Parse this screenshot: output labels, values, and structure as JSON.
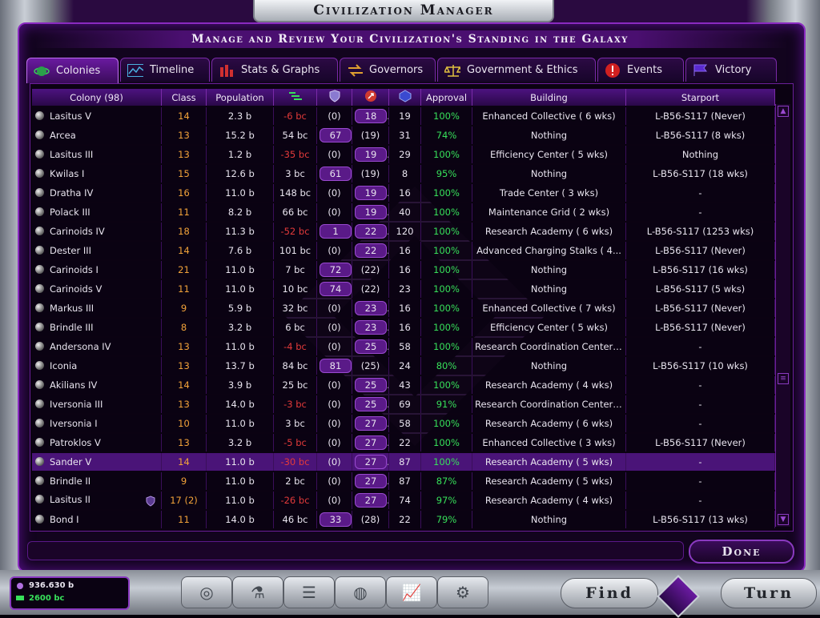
{
  "window": {
    "title": "Civilization Manager",
    "subtitle": "Manage and Review Your Civilization's Standing in the Galaxy"
  },
  "tabs": [
    {
      "label": "Colonies",
      "icon": "planet-icon",
      "active": true
    },
    {
      "label": "Timeline",
      "icon": "timeline-icon",
      "active": false
    },
    {
      "label": "Stats & Graphs",
      "icon": "bar-graph-icon",
      "active": false
    },
    {
      "label": "Governors",
      "icon": "governors-arrows-icon",
      "active": false
    },
    {
      "label": "Government & Ethics",
      "icon": "scales-icon",
      "active": false
    },
    {
      "label": "Events",
      "icon": "alert-icon",
      "active": false
    },
    {
      "label": "Victory",
      "icon": "flag-icon",
      "active": false
    }
  ],
  "table": {
    "headers": {
      "colony": "Colony (98)",
      "class": "Class",
      "population": "Population",
      "income_icon": "income-icon",
      "shield_icon": "shield-icon",
      "influence_icon": "influence-icon",
      "research_icon": "research-icon",
      "approval": "Approval",
      "building": "Building",
      "starport": "Starport"
    },
    "rows": [
      {
        "name": "Lasitus V",
        "cls": "14",
        "pop": "2.3 b",
        "income": "-6 bc",
        "def": "(0)",
        "inf": "18",
        "res": "19",
        "approval": "100%",
        "building": "Enhanced Collective ( 6 wks)",
        "starport": "L-B56-S117 (Never)"
      },
      {
        "name": "Arcea",
        "cls": "13",
        "pop": "15.2 b",
        "income": "54 bc",
        "def": "67",
        "inf": "(19)",
        "res": "31",
        "approval": "74%",
        "building": "Nothing",
        "starport": "L-B56-S117 (8 wks)"
      },
      {
        "name": "Lasitus III",
        "cls": "13",
        "pop": "1.2 b",
        "income": "-35 bc",
        "def": "(0)",
        "inf": "19",
        "res": "29",
        "approval": "100%",
        "building": "Efficiency Center ( 5 wks)",
        "starport": "Nothing"
      },
      {
        "name": "Kwilas I",
        "cls": "15",
        "pop": "12.6 b",
        "income": "3 bc",
        "def": "61",
        "inf": "(19)",
        "res": "8",
        "approval": "95%",
        "building": "Nothing",
        "starport": "L-B56-S117 (18 wks)"
      },
      {
        "name": "Dratha IV",
        "cls": "16",
        "pop": "11.0 b",
        "income": "148 bc",
        "def": "(0)",
        "inf": "19",
        "res": "16",
        "approval": "100%",
        "building": "Trade Center ( 3 wks)",
        "starport": "-"
      },
      {
        "name": "Polack III",
        "cls": "11",
        "pop": "8.2 b",
        "income": "66 bc",
        "def": "(0)",
        "inf": "19",
        "res": "40",
        "approval": "100%",
        "building": "Maintenance Grid ( 2 wks)",
        "starport": "-"
      },
      {
        "name": "Carinoids IV",
        "cls": "18",
        "pop": "11.3 b",
        "income": "-52 bc",
        "def": "1",
        "inf": "22",
        "res": "120",
        "approval": "100%",
        "building": "Research Academy ( 6 wks)",
        "starport": "L-B56-S117 (1253 wks)"
      },
      {
        "name": "Dester III",
        "cls": "14",
        "pop": "7.6 b",
        "income": "101 bc",
        "def": "(0)",
        "inf": "22",
        "res": "16",
        "approval": "100%",
        "building": "Advanced Charging Stalks ( 4...",
        "starport": "L-B56-S117 (Never)"
      },
      {
        "name": "Carinoids I",
        "cls": "21",
        "pop": "11.0 b",
        "income": "7 bc",
        "def": "72",
        "inf": "(22)",
        "res": "16",
        "approval": "100%",
        "building": "Nothing",
        "starport": "L-B56-S117 (16 wks)"
      },
      {
        "name": "Carinoids V",
        "cls": "11",
        "pop": "11.0 b",
        "income": "10 bc",
        "def": "74",
        "inf": "(22)",
        "res": "23",
        "approval": "100%",
        "building": "Nothing",
        "starport": "L-B56-S117 (5 wks)"
      },
      {
        "name": "Markus III",
        "cls": "9",
        "pop": "5.9 b",
        "income": "32 bc",
        "def": "(0)",
        "inf": "23",
        "res": "16",
        "approval": "100%",
        "building": "Enhanced Collective ( 7 wks)",
        "starport": "L-B56-S117 (Never)"
      },
      {
        "name": "Brindle III",
        "cls": "8",
        "pop": "3.2 b",
        "income": "6 bc",
        "def": "(0)",
        "inf": "23",
        "res": "16",
        "approval": "100%",
        "building": "Efficiency Center ( 5 wks)",
        "starport": "L-B56-S117 (Never)"
      },
      {
        "name": "Andersona IV",
        "cls": "13",
        "pop": "11.0 b",
        "income": "-4 bc",
        "def": "(0)",
        "inf": "25",
        "res": "58",
        "approval": "100%",
        "building": "Research Coordination Center ...",
        "starport": "-"
      },
      {
        "name": "Iconia",
        "cls": "13",
        "pop": "13.7 b",
        "income": "84 bc",
        "def": "81",
        "inf": "(25)",
        "res": "24",
        "approval": "80%",
        "building": "Nothing",
        "starport": "L-B56-S117 (10 wks)"
      },
      {
        "name": "Akilians IV",
        "cls": "14",
        "pop": "3.9 b",
        "income": "25 bc",
        "def": "(0)",
        "inf": "25",
        "res": "43",
        "approval": "100%",
        "building": "Research Academy ( 4 wks)",
        "starport": "-"
      },
      {
        "name": "Iversonia III",
        "cls": "13",
        "pop": "14.0 b",
        "income": "-3 bc",
        "def": "(0)",
        "inf": "25",
        "res": "69",
        "approval": "91%",
        "building": "Research Coordination Center ...",
        "starport": "-"
      },
      {
        "name": "Iversonia I",
        "cls": "10",
        "pop": "11.0 b",
        "income": "3 bc",
        "def": "(0)",
        "inf": "27",
        "res": "58",
        "approval": "100%",
        "building": "Research Academy ( 6 wks)",
        "starport": "-"
      },
      {
        "name": "Patroklos V",
        "cls": "13",
        "pop": "3.2 b",
        "income": "-5 bc",
        "def": "(0)",
        "inf": "27",
        "res": "22",
        "approval": "100%",
        "building": "Enhanced Collective ( 3 wks)",
        "starport": "L-B56-S117 (Never)"
      },
      {
        "name": "Sander V",
        "cls": "14",
        "pop": "11.0 b",
        "income": "-30 bc",
        "def": "(0)",
        "inf": "27",
        "res": "87",
        "approval": "100%",
        "building": "Research Academy ( 5 wks)",
        "starport": "-",
        "selected": true
      },
      {
        "name": "Brindle II",
        "cls": "9",
        "pop": "11.0 b",
        "income": "2 bc",
        "def": "(0)",
        "inf": "27",
        "res": "87",
        "approval": "87%",
        "building": "Research Academy ( 5 wks)",
        "starport": "-"
      },
      {
        "name": "Lasitus II",
        "cls": "17 (2)",
        "pop": "11.0 b",
        "income": "-26 bc",
        "def": "(0)",
        "inf": "27",
        "res": "74",
        "approval": "97%",
        "building": "Research Academy ( 4 wks)",
        "starport": "-",
        "shield": true
      },
      {
        "name": "Bond I",
        "cls": "11",
        "pop": "14.0 b",
        "income": "46 bc",
        "def": "33",
        "inf": "(28)",
        "res": "22",
        "approval": "79%",
        "building": "Nothing",
        "starport": "L-B56-S117 (13 wks)"
      }
    ]
  },
  "done_label": "Done",
  "treasury": {
    "population": "936.630 b",
    "credits": "2600 bc"
  },
  "bottom_nav": [
    {
      "icon": "colony-ship-icon"
    },
    {
      "icon": "flask-icon"
    },
    {
      "icon": "government-icon"
    },
    {
      "icon": "planet-grid-icon"
    },
    {
      "icon": "chart-icon"
    },
    {
      "icon": "shipyard-icon"
    }
  ],
  "find_label": "Find",
  "turn_label": "Turn",
  "colors": {
    "accent": "#8a2ac0",
    "positive": "#37e05a",
    "negative": "#e23a3a",
    "class": "#f2a23a"
  }
}
